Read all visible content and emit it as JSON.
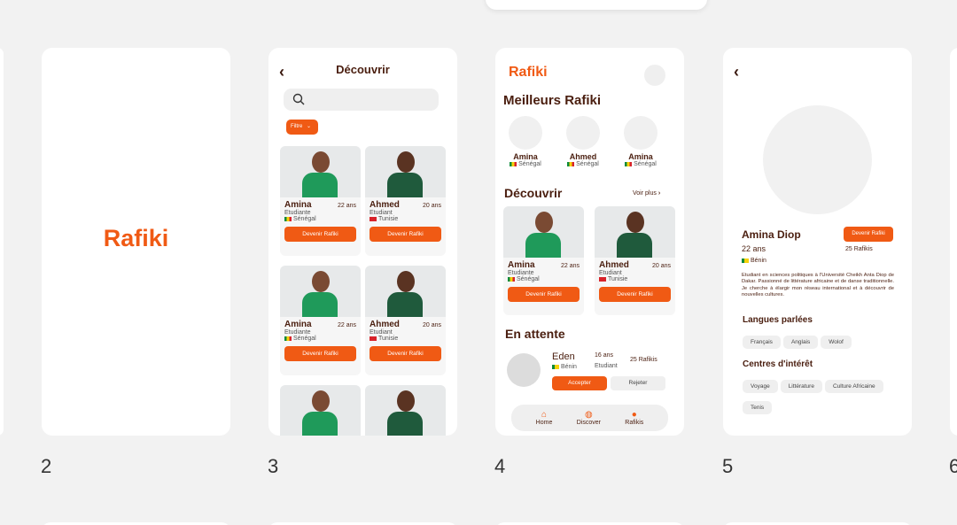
{
  "frame_numbers": [
    "2",
    "3",
    "4",
    "5",
    "6"
  ],
  "splash": {
    "logo": "Rafiki"
  },
  "discover": {
    "title": "Découvrir",
    "filter_label": "Filtre",
    "cards": [
      {
        "name": "Amina",
        "age": "22 ans",
        "role": "Etudiante",
        "country": "Sénégal",
        "cta": "Devenir Rafiki"
      },
      {
        "name": "Ahmed",
        "age": "20 ans",
        "role": "Etudiant",
        "country": "Tunisie",
        "cta": "Devenir Rafiki"
      },
      {
        "name": "Amina",
        "age": "22 ans",
        "role": "Etudiante",
        "country": "Sénégal",
        "cta": "Devenir Rafiki"
      },
      {
        "name": "Ahmed",
        "age": "20 ans",
        "role": "Etudiant",
        "country": "Tunisie",
        "cta": "Devenir Rafiki"
      }
    ]
  },
  "home": {
    "logo": "Rafiki",
    "best_title": "Meilleurs Rafiki",
    "best": [
      {
        "name": "Amina",
        "country": "Sénégal"
      },
      {
        "name": "Ahmed",
        "country": "Sénégal"
      },
      {
        "name": "Amina",
        "country": "Sénégal"
      }
    ],
    "discover_title": "Découvrir",
    "see_more": "Voir plus",
    "cards": [
      {
        "name": "Amina",
        "age": "22 ans",
        "role": "Etudiante",
        "country": "Sénégal",
        "cta": "Devenir Rafiki"
      },
      {
        "name": "Ahmed",
        "age": "20 ans",
        "role": "Etudiant",
        "country": "Tunisie",
        "cta": "Devenir Rafiki"
      }
    ],
    "pending_title": "En attente",
    "pending": {
      "name": "Eden",
      "age": "16 ans",
      "role": "Etudiant",
      "country": "Bénin",
      "count": "25 Rafikis",
      "accept": "Accepter",
      "reject": "Rejeter"
    },
    "nav": [
      {
        "label": "Home",
        "icon": "home-icon"
      },
      {
        "label": "Discover",
        "icon": "globe-icon"
      },
      {
        "label": "Rafikis",
        "icon": "people-icon"
      }
    ]
  },
  "profile": {
    "name": "Amina Diop",
    "age": "22 ans",
    "country": "Bénin",
    "cta": "Devenir Rafiki",
    "count": "25 Rafikis",
    "bio": "Etudiant en sciences politiques à l'Université Cheikh Anta Diop de Dakar. Passionné de littérature africaine et de danse traditionnelle. Je cherche à élargir mon réseau international et à découvrir de nouvelles cultures.",
    "languages_title": "Langues parlées",
    "languages": [
      "Français",
      "Anglais",
      "Wolof"
    ],
    "interests_title": "Centres d'intérêt",
    "interests": [
      "Voyage",
      "Littérature",
      "Culture Africaine",
      "Tenis"
    ]
  },
  "colors": {
    "accent": "#f05a14",
    "text_dark": "#4a1e0f",
    "background": "#f2f2f2"
  }
}
